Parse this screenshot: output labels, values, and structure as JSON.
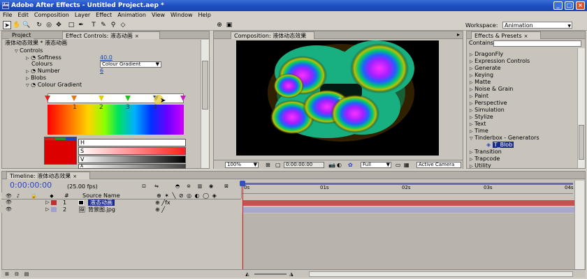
{
  "window": {
    "title": "Adobe After Effects - Untitled Project.aep *",
    "min": "_",
    "max": "□",
    "close": "×"
  },
  "menu": [
    "File",
    "Edit",
    "Composition",
    "Layer",
    "Effect",
    "Animation",
    "View",
    "Window",
    "Help"
  ],
  "toolbar": {
    "workspace_label": "Workspace:",
    "workspace_value": "Animation"
  },
  "project_panel": {
    "tab_project": "Project",
    "tab_effect_controls": "Effect Controls: 液态动画",
    "breadcrumb": "液体动态效果 * 液态动画",
    "rows": {
      "controls": "Controls",
      "softness_label": "Softness",
      "softness_value": "40.0",
      "colours_label": "Colours",
      "colours_value": "Colour Gradient",
      "number_label": "Number",
      "number_value": "6",
      "blobs_label": "Blobs",
      "colour_gradient_label": "Colour Gradient"
    },
    "stop_numbers": [
      "1",
      "2",
      "3",
      "4"
    ],
    "hsv": {
      "h": "H",
      "s": "S",
      "v": "V",
      "a": "A"
    }
  },
  "composition_panel": {
    "tab": "Composition: 液体动态效果",
    "footer": {
      "zoom": "100%",
      "timecode": "0:00:00:00",
      "resolution": "Full",
      "camera": "Active Camera"
    }
  },
  "effects_panel": {
    "tab": "Effects & Presets",
    "contains_label": "Contains:",
    "items": [
      "DragonFly",
      "Expression Controls",
      "Generate",
      "Keying",
      "Matte",
      "Noise & Grain",
      "Paint",
      "Perspective",
      "Simulation",
      "Stylize",
      "Text",
      "Time",
      "Tinderbox - Generators",
      "T_Blob",
      "Transition",
      "Trapcode",
      "Utility"
    ]
  },
  "timeline": {
    "tab": "Timeline: 液体动态效果",
    "timecode": "0:00:00:00",
    "fps": "(25.00 fps)",
    "col_number": "#",
    "col_source": "Source Name",
    "ruler": [
      "0s",
      "01s",
      "02s",
      "03s",
      "04s"
    ],
    "layers": [
      {
        "num": "1",
        "name": "液态动画",
        "color": "#c03030"
      },
      {
        "num": "2",
        "name": "背景图.jpg",
        "color": "#a0a0d0"
      }
    ]
  },
  "colors": {
    "accent": "#1e4fc0",
    "layer1_bar": "#c85050",
    "layer2_bar": "#a8a8cc",
    "timecode": "#2a44c8"
  }
}
